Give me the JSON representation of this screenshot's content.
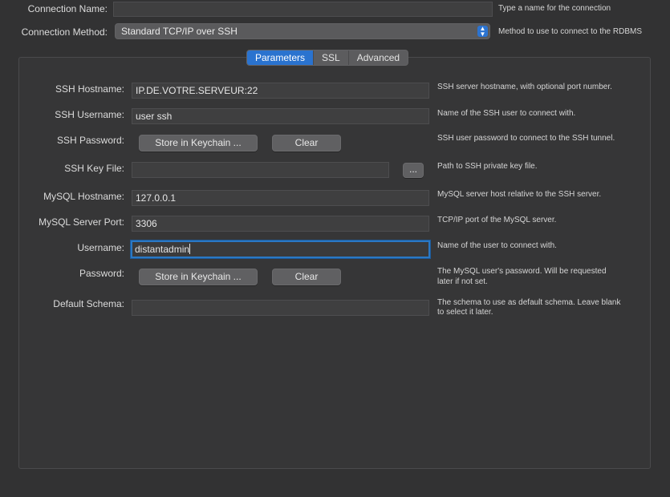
{
  "top": {
    "connection_name_label": "Connection Name:",
    "connection_name_value": "",
    "connection_name_help": "Type a name for the connection",
    "connection_method_label": "Connection Method:",
    "connection_method_value": "Standard TCP/IP over SSH",
    "connection_method_help": "Method to use to connect to the RDBMS"
  },
  "tabs": [
    {
      "label": "Parameters",
      "active": true
    },
    {
      "label": "SSL",
      "active": false
    },
    {
      "label": "Advanced",
      "active": false
    }
  ],
  "params": {
    "ssh_hostname": {
      "label": "SSH Hostname:",
      "value": "IP.DE.VOTRE.SERVEUR:22",
      "help": "SSH server hostname, with  optional port number."
    },
    "ssh_username": {
      "label": "SSH Username:",
      "value": "user ssh",
      "help": "Name of the SSH user to connect with."
    },
    "ssh_password": {
      "label": "SSH Password:",
      "store_label": "Store in Keychain ...",
      "clear_label": "Clear",
      "help": "SSH user password to connect to the SSH tunnel."
    },
    "ssh_key_file": {
      "label": "SSH Key File:",
      "value": "",
      "browse_label": "...",
      "help": "Path to SSH private key file."
    },
    "mysql_hostname": {
      "label": "MySQL Hostname:",
      "value": "127.0.0.1",
      "help": "MySQL server host relative to the SSH server."
    },
    "mysql_port": {
      "label": "MySQL Server Port:",
      "value": "3306",
      "help": "TCP/IP port of the MySQL server."
    },
    "username": {
      "label": "Username:",
      "value": "distantadmin",
      "help": "Name of the user to connect with."
    },
    "password": {
      "label": "Password:",
      "store_label": "Store in Keychain ...",
      "clear_label": "Clear",
      "help_line1": "The MySQL user's password. Will be requested",
      "help_line2": "later if not set."
    },
    "default_schema": {
      "label": "Default Schema:",
      "value": "",
      "help_line1": "The schema to use as default schema. Leave blank",
      "help_line2": "to select it later."
    }
  },
  "colors": {
    "accent": "#2a73cf",
    "background": "#323233"
  }
}
